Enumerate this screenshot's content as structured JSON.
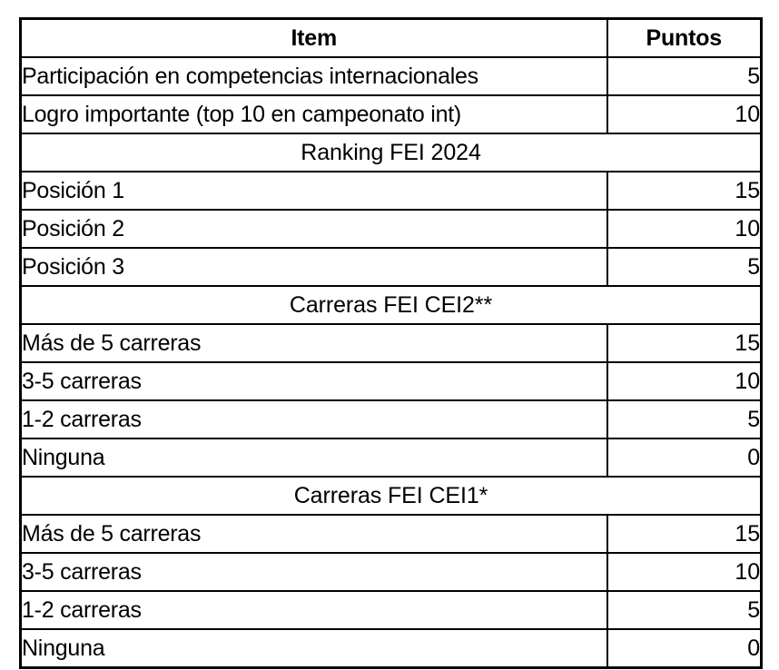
{
  "table": {
    "headers": {
      "item": "Item",
      "puntos": "Puntos"
    },
    "rows": [
      {
        "kind": "data",
        "item": "Participación en competencias internacionales",
        "puntos": "5"
      },
      {
        "kind": "data",
        "item": "Logro importante (top 10 en campeonato int)",
        "puntos": "10"
      },
      {
        "kind": "section",
        "item": "Ranking FEI 2024",
        "puntos": ""
      },
      {
        "kind": "data",
        "item": "Posición 1",
        "puntos": "15"
      },
      {
        "kind": "data",
        "item": "Posición 2",
        "puntos": "10"
      },
      {
        "kind": "data",
        "item": "Posición 3",
        "puntos": "5"
      },
      {
        "kind": "section",
        "item": "Carreras FEI CEI2**",
        "puntos": ""
      },
      {
        "kind": "data",
        "item": "Más de 5 carreras",
        "puntos": "15"
      },
      {
        "kind": "data",
        "item": "3-5 carreras",
        "puntos": "10"
      },
      {
        "kind": "data",
        "item": "1-2 carreras",
        "puntos": "5"
      },
      {
        "kind": "data",
        "item": "Ninguna",
        "puntos": "0"
      },
      {
        "kind": "section",
        "item": "Carreras FEI CEI1*",
        "puntos": ""
      },
      {
        "kind": "data",
        "item": "Más de 5 carreras",
        "puntos": "15"
      },
      {
        "kind": "data",
        "item": "3-5 carreras",
        "puntos": "10"
      },
      {
        "kind": "data",
        "item": "1-2 carreras",
        "puntos": "5"
      },
      {
        "kind": "data",
        "item": "Ninguna",
        "puntos": "0"
      }
    ]
  },
  "colors": {
    "border": "#000000",
    "text": "#000000",
    "background": "#FFFFFF"
  }
}
